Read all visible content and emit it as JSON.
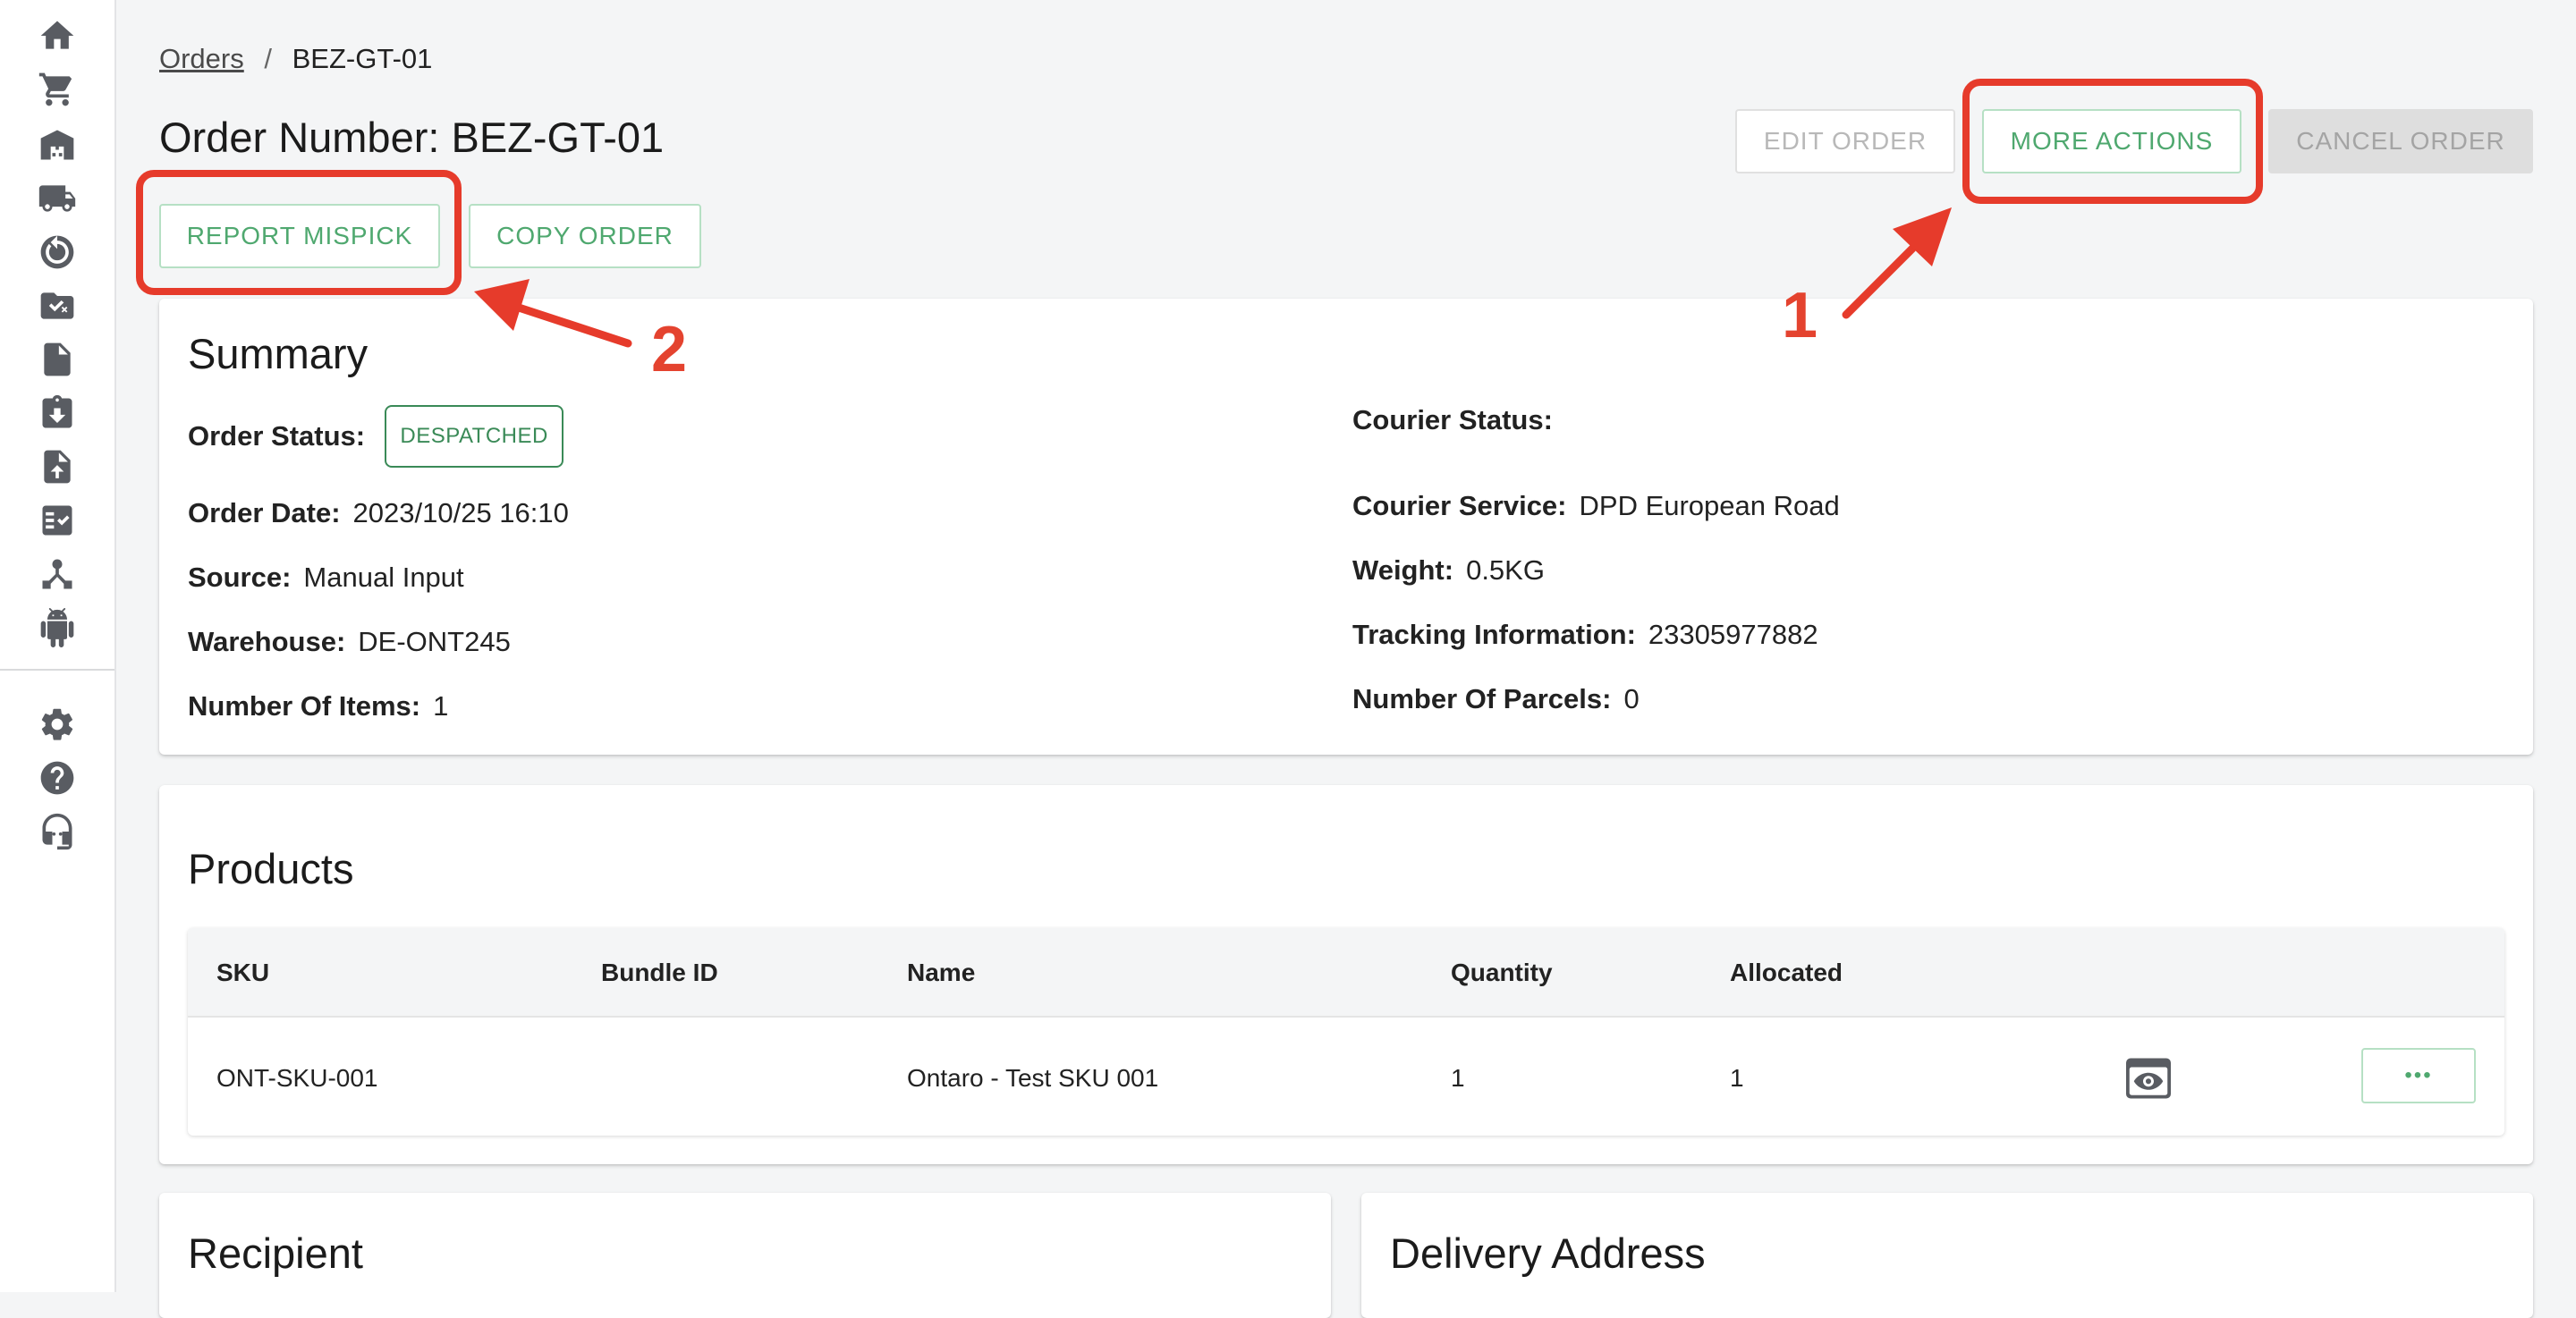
{
  "sidebar": {
    "items": [
      {
        "icon": "home-icon"
      },
      {
        "icon": "cart-icon"
      },
      {
        "icon": "warehouse-icon"
      },
      {
        "icon": "truck-icon"
      },
      {
        "icon": "returns-icon"
      },
      {
        "icon": "folder-cancel-icon"
      },
      {
        "icon": "document-icon"
      },
      {
        "icon": "inbound-icon"
      },
      {
        "icon": "outbound-icon"
      },
      {
        "icon": "checklist-icon"
      },
      {
        "icon": "integrations-icon"
      },
      {
        "icon": "android-icon"
      }
    ],
    "bottom_items": [
      {
        "icon": "gear-icon"
      },
      {
        "icon": "help-icon"
      },
      {
        "icon": "support-headset-icon"
      }
    ]
  },
  "breadcrumb": {
    "parent": "Orders",
    "separator": "/",
    "current": "BEZ-GT-01"
  },
  "header": {
    "title": "Order Number: BEZ-GT-01",
    "report_mispick": "REPORT MISPICK",
    "copy_order": "COPY ORDER",
    "edit_order": "EDIT ORDER",
    "more_actions": "MORE ACTIONS",
    "cancel_order": "CANCEL ORDER"
  },
  "annotations": {
    "label_1": "1",
    "label_2": "2",
    "color": "#e63b2b"
  },
  "summary": {
    "title": "Summary",
    "order_status_label": "Order Status:",
    "order_status_value": "DESPATCHED",
    "order_date_label": "Order Date:",
    "order_date_value": "2023/10/25 16:10",
    "source_label": "Source:",
    "source_value": "Manual Input",
    "warehouse_label": "Warehouse:",
    "warehouse_value": "DE-ONT245",
    "items_label": "Number Of Items:",
    "items_value": "1",
    "courier_status_label": "Courier Status:",
    "courier_service_label": "Courier Service:",
    "courier_service_value": "DPD European Road",
    "weight_label": "Weight:",
    "weight_value": "0.5KG",
    "tracking_label": "Tracking Information:",
    "tracking_value": "23305977882",
    "parcels_label": "Number Of Parcels:",
    "parcels_value": "0"
  },
  "products": {
    "title": "Products",
    "columns": [
      "SKU",
      "Bundle ID",
      "Name",
      "Quantity",
      "Allocated"
    ],
    "rows": [
      {
        "sku": "ONT-SKU-001",
        "bundle_id": "",
        "name": "Ontaro - Test SKU 001",
        "quantity": "1",
        "allocated": "1",
        "more": "•••"
      }
    ]
  },
  "recipient": {
    "title": "Recipient"
  },
  "delivery": {
    "title": "Delivery Address"
  },
  "colors": {
    "accent": "#4fa86f",
    "status": "#3a8a57",
    "annotation": "#e63b2b"
  }
}
